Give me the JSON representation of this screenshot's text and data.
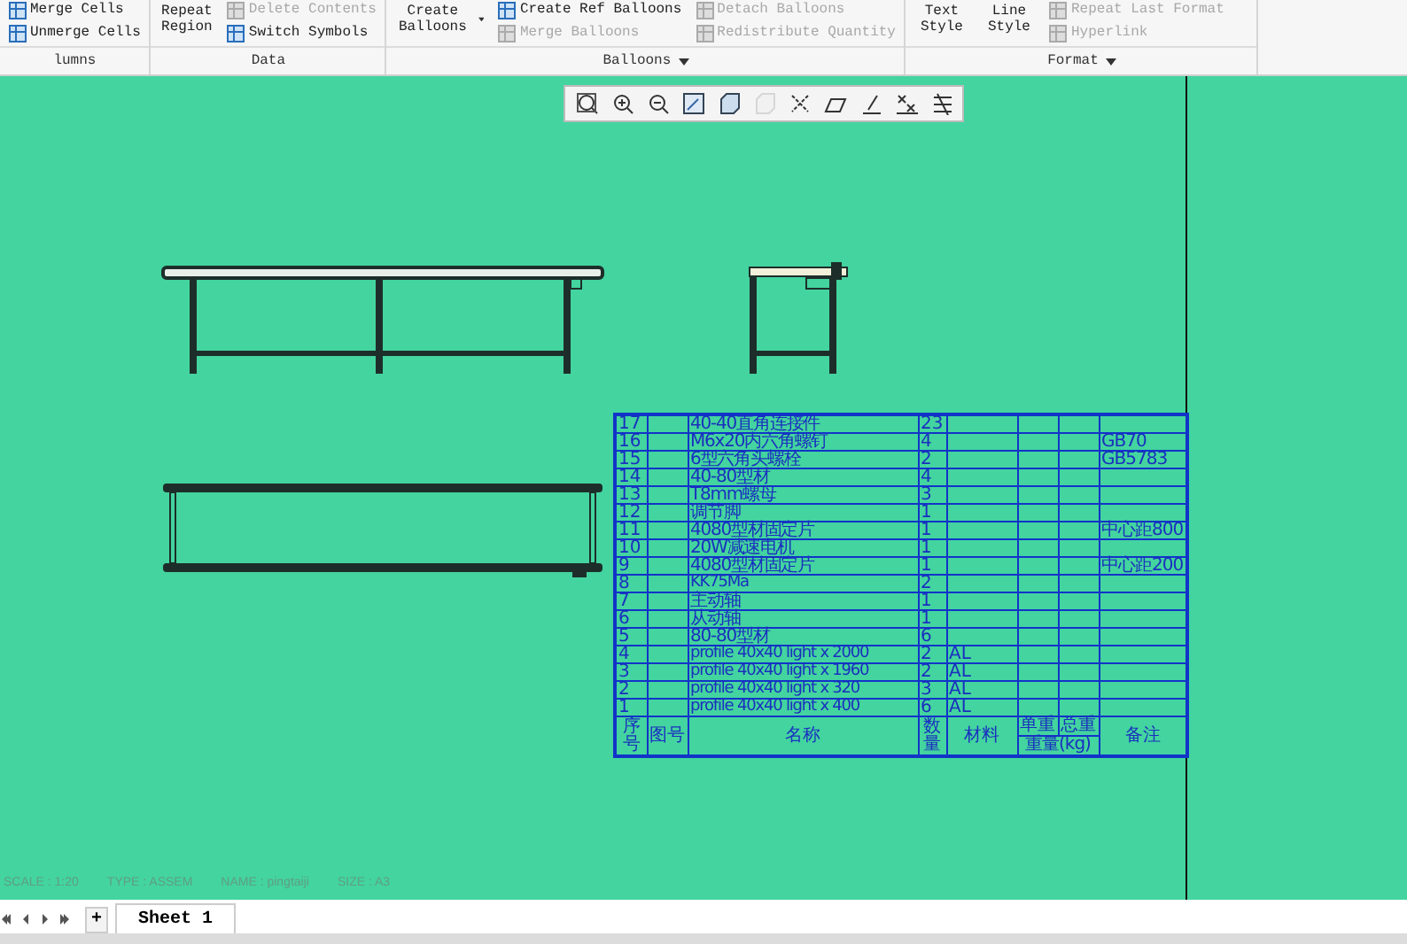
{
  "ribbon": {
    "groups": [
      {
        "label": "lumns",
        "dropdown": false,
        "columns": [
          [
            {
              "label": "Merge Cells",
              "kind": "small",
              "disabled": false
            },
            {
              "label": "Unmerge Cells",
              "kind": "small",
              "disabled": false
            }
          ]
        ]
      },
      {
        "label": "Data",
        "dropdown": false,
        "columns": [
          [
            {
              "label": "Repeat Region",
              "kind": "large",
              "disabled": false,
              "dropdown": false
            }
          ],
          [
            {
              "label": "Delete Contents",
              "kind": "small",
              "disabled": true
            },
            {
              "label": "Switch Symbols",
              "kind": "small",
              "disabled": false
            }
          ]
        ]
      },
      {
        "label": "Balloons",
        "dropdown": true,
        "columns": [
          [
            {
              "label": "Create Balloons",
              "kind": "large",
              "disabled": false,
              "dropdown": true
            }
          ],
          [
            {
              "label": "Create Ref Balloons",
              "kind": "small",
              "disabled": false
            },
            {
              "label": "Merge Balloons",
              "kind": "small",
              "disabled": true
            }
          ],
          [
            {
              "label": "Detach Balloons",
              "kind": "small",
              "disabled": true
            },
            {
              "label": "Redistribute Quantity",
              "kind": "small",
              "disabled": true
            }
          ]
        ]
      },
      {
        "label": "Format",
        "dropdown": true,
        "columns": [
          [
            {
              "label": "Text Style",
              "kind": "large",
              "disabled": false,
              "dropdown": false
            }
          ],
          [
            {
              "label": "Line Style",
              "kind": "large",
              "disabled": false,
              "dropdown": false
            }
          ],
          [
            {
              "label": "Repeat Last Format",
              "kind": "small",
              "disabled": true
            },
            {
              "label": "Hyperlink",
              "kind": "small",
              "disabled": true
            }
          ]
        ]
      }
    ]
  },
  "view_toolbar": {
    "buttons": [
      {
        "disabled": false
      },
      {
        "disabled": false
      },
      {
        "disabled": false
      },
      {
        "disabled": false
      },
      {
        "disabled": false
      },
      {
        "disabled": true
      },
      {
        "disabled": false
      },
      {
        "disabled": false
      },
      {
        "disabled": false
      },
      {
        "disabled": false
      },
      {
        "disabled": false
      }
    ]
  },
  "bom_table": {
    "rows": [
      [
        "17",
        "",
        "40-40直角连接件",
        "23",
        "",
        "",
        "",
        ""
      ],
      [
        "16",
        "",
        "M6x20内六角螺钉",
        "4",
        "",
        "",
        "",
        "GB70"
      ],
      [
        "15",
        "",
        "6型六角头螺栓",
        "2",
        "",
        "",
        "",
        "GB5783"
      ],
      [
        "14",
        "",
        "40-80型材",
        "4",
        "",
        "",
        "",
        ""
      ],
      [
        "13",
        "",
        "T8mm螺母",
        "3",
        "",
        "",
        "",
        ""
      ],
      [
        "12",
        "",
        "调节脚",
        "1",
        "",
        "",
        "",
        ""
      ],
      [
        "11",
        "",
        "4080型材固定片",
        "1",
        "",
        "",
        "",
        "中心距800"
      ],
      [
        "10",
        "",
        "20W减速电机",
        "1",
        "",
        "",
        "",
        ""
      ],
      [
        "9",
        "",
        "4080型材固定片",
        "1",
        "",
        "",
        "",
        "中心距200"
      ],
      [
        "8",
        "",
        "KK75Ma",
        "2",
        "",
        "",
        "",
        ""
      ],
      [
        "7",
        "",
        "主动轴",
        "1",
        "",
        "",
        "",
        ""
      ],
      [
        "6",
        "",
        "从动轴",
        "1",
        "",
        "",
        "",
        ""
      ],
      [
        "5",
        "",
        "80-80型材",
        "6",
        "",
        "",
        "",
        ""
      ],
      [
        "4",
        "",
        "profile 40x40 light x 2000",
        "2",
        "AL",
        "",
        "",
        ""
      ],
      [
        "3",
        "",
        "profile 40x40 light x 1960",
        "2",
        "AL",
        "",
        "",
        ""
      ],
      [
        "2",
        "",
        "profile 40x40 light x 320",
        "3",
        "AL",
        "",
        "",
        ""
      ],
      [
        "1",
        "",
        "profile 40x40 light x 400",
        "6",
        "AL",
        "",
        "",
        ""
      ]
    ],
    "header": {
      "index": "序号",
      "drawing_no": "图号",
      "name": "名称",
      "quantity": "数量",
      "material": "材料",
      "unit_weight": "单重",
      "total_weight": "总重",
      "weight": "重量(kg)",
      "remark": "备注"
    }
  },
  "status": [
    "SCALE : 1:20",
    "TYPE : ASSEM",
    "NAME : pingtaiji",
    "SIZE : A3"
  ],
  "sheet_bar": {
    "add": "+",
    "tabs": [
      {
        "label": "Sheet 1",
        "selected": true
      }
    ]
  }
}
